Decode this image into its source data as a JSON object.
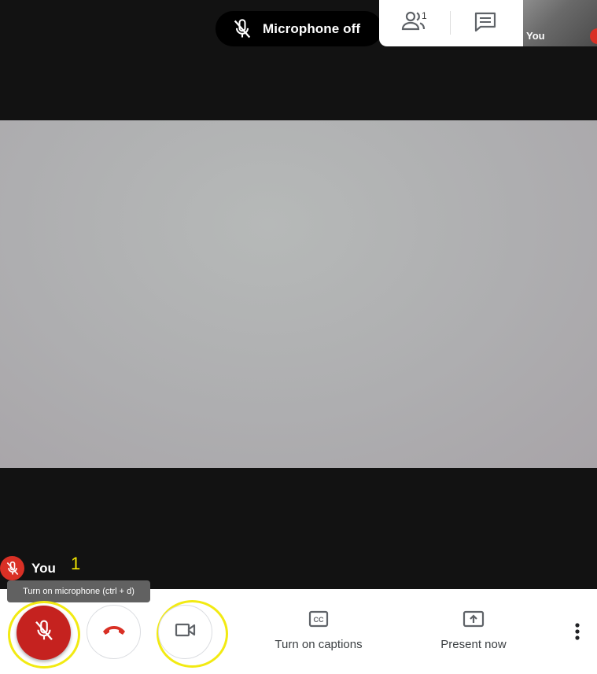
{
  "notification": {
    "text": "Microphone off",
    "icon": "mic-off-icon"
  },
  "top_panel": {
    "people_icon": "people-icon",
    "people_count": "1",
    "chat_icon": "chat-icon"
  },
  "self_view": {
    "label": "You",
    "mic_status_icon": "mic-off-icon"
  },
  "participant": {
    "name": "You",
    "annotation": "1"
  },
  "tooltip": {
    "text": "Turn on microphone (ctrl + d)"
  },
  "controls": {
    "mic_icon": "mic-off-icon",
    "end_icon": "phone-hangup-icon",
    "camera_icon": "video-camera-icon",
    "captions_label": "Turn on captions",
    "captions_icon": "cc-icon",
    "present_label": "Present now",
    "present_icon": "present-screen-icon",
    "more_icon": "more-vert-icon"
  },
  "colors": {
    "mic_off_red": "#c5221f",
    "highlight_yellow": "#f2ea12",
    "end_call_red": "#d93025"
  }
}
